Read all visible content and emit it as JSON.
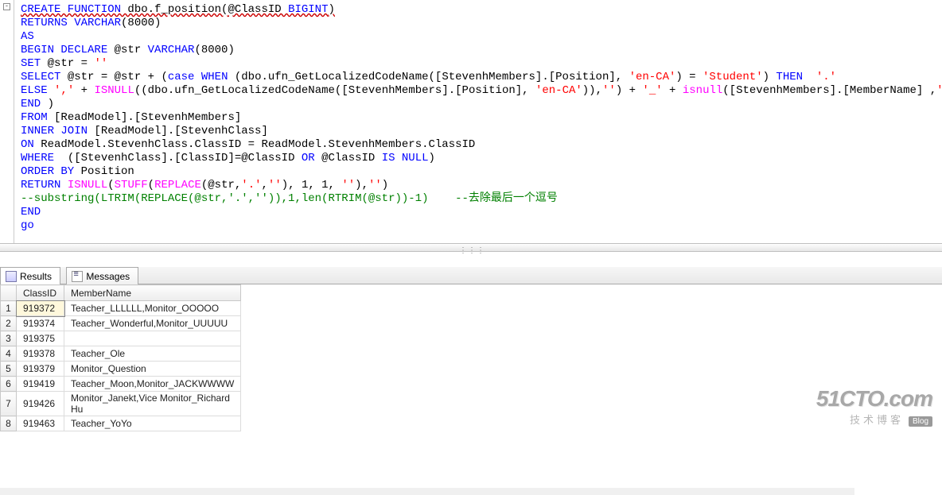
{
  "code": {
    "tokens": [
      [
        {
          "t": "CREATE FUNCTION",
          "c": "kw underline-squiggle"
        },
        {
          "t": " dbo.f_position(@ClassID ",
          "c": "underline-squiggle"
        },
        {
          "t": "BIGINT",
          "c": "kw underline-squiggle"
        },
        {
          "t": ")",
          "c": "underline-squiggle"
        }
      ],
      [
        {
          "t": "RETURNS VARCHAR",
          "c": "kw"
        },
        {
          "t": "(8000)"
        }
      ],
      [
        {
          "t": "AS",
          "c": "kw"
        }
      ],
      [
        {
          "t": "BEGIN DECLARE",
          "c": "kw"
        },
        {
          "t": " @str "
        },
        {
          "t": "VARCHAR",
          "c": "kw"
        },
        {
          "t": "(8000)"
        }
      ],
      [
        {
          "t": "SET",
          "c": "kw"
        },
        {
          "t": " @str = "
        },
        {
          "t": "''",
          "c": "str"
        }
      ],
      [
        {
          "t": "SELECT",
          "c": "kw"
        },
        {
          "t": " @str = @str + ("
        },
        {
          "t": "case",
          "c": "kw"
        },
        {
          "t": " "
        },
        {
          "t": "WHEN",
          "c": "kw"
        },
        {
          "t": " (dbo.ufn_GetLocalizedCodeName([StevenhMembers].[Position], "
        },
        {
          "t": "'en-CA'",
          "c": "str"
        },
        {
          "t": ") = "
        },
        {
          "t": "'Student'",
          "c": "str"
        },
        {
          "t": ") "
        },
        {
          "t": "THEN",
          "c": "kw"
        },
        {
          "t": "  "
        },
        {
          "t": "'.'",
          "c": "str"
        }
      ],
      [
        {
          "t": "ELSE",
          "c": "kw"
        },
        {
          "t": " "
        },
        {
          "t": "','",
          "c": "str"
        },
        {
          "t": " + "
        },
        {
          "t": "ISNULL",
          "c": "fn"
        },
        {
          "t": "((dbo.ufn_GetLocalizedCodeName([StevenhMembers].[Position], "
        },
        {
          "t": "'en-CA'",
          "c": "str"
        },
        {
          "t": ")),"
        },
        {
          "t": "''",
          "c": "str"
        },
        {
          "t": ") + "
        },
        {
          "t": "'_'",
          "c": "str"
        },
        {
          "t": " + "
        },
        {
          "t": "isnull",
          "c": "fn"
        },
        {
          "t": "([StevenhMembers].[MemberName] ,"
        },
        {
          "t": "''",
          "c": "str"
        },
        {
          "t": ")"
        }
      ],
      [
        {
          "t": "END",
          "c": "kw"
        },
        {
          "t": " )"
        }
      ],
      [
        {
          "t": "FROM",
          "c": "kw"
        },
        {
          "t": " [ReadModel].[StevenhMembers]"
        }
      ],
      [
        {
          "t": "INNER JOIN",
          "c": "kw"
        },
        {
          "t": " [ReadModel].[StevenhClass]"
        }
      ],
      [
        {
          "t": "ON",
          "c": "kw"
        },
        {
          "t": " ReadModel.StevenhClass.ClassID = ReadModel.StevenhMembers.ClassID"
        }
      ],
      [
        {
          "t": "WHERE",
          "c": "kw"
        },
        {
          "t": "  ([StevenhClass].[ClassID]=@ClassID "
        },
        {
          "t": "OR",
          "c": "kw"
        },
        {
          "t": " @ClassID "
        },
        {
          "t": "IS NULL",
          "c": "kw"
        },
        {
          "t": ")"
        }
      ],
      [
        {
          "t": "ORDER BY",
          "c": "kw"
        },
        {
          "t": " Position"
        }
      ],
      [
        {
          "t": "RETURN ",
          "c": "kw"
        },
        {
          "t": "ISNULL",
          "c": "fn"
        },
        {
          "t": "("
        },
        {
          "t": "STUFF",
          "c": "fn"
        },
        {
          "t": "("
        },
        {
          "t": "REPLACE",
          "c": "fn"
        },
        {
          "t": "(@str,"
        },
        {
          "t": "'.'",
          "c": "str"
        },
        {
          "t": ","
        },
        {
          "t": "''",
          "c": "str"
        },
        {
          "t": "), 1, 1, "
        },
        {
          "t": "''",
          "c": "str"
        },
        {
          "t": "),"
        },
        {
          "t": "''",
          "c": "str"
        },
        {
          "t": ")"
        }
      ],
      [
        {
          "t": "--substring(LTRIM(REPLACE(@str,'.','')),1,len(RTRIM(@str))-1)    --去除最后一个逗号",
          "c": "cmt"
        }
      ],
      [
        {
          "t": "END",
          "c": "kw"
        }
      ],
      [
        {
          "t": "go",
          "c": "kw"
        }
      ]
    ]
  },
  "tabs": {
    "results": "Results",
    "messages": "Messages"
  },
  "grid": {
    "headers": {
      "classid": "ClassID",
      "member": "MemberName"
    },
    "rows": [
      {
        "n": "1",
        "classid": "919372",
        "member": "Teacher_LLLLLL,Monitor_OOOOO"
      },
      {
        "n": "2",
        "classid": "919374",
        "member": "Teacher_Wonderful,Monitor_UUUUU"
      },
      {
        "n": "3",
        "classid": "919375",
        "member": ""
      },
      {
        "n": "4",
        "classid": "919378",
        "member": "Teacher_Ole"
      },
      {
        "n": "5",
        "classid": "919379",
        "member": "Monitor_Question"
      },
      {
        "n": "6",
        "classid": "919419",
        "member": "Teacher_Moon,Monitor_JACKWWWW"
      },
      {
        "n": "7",
        "classid": "919426",
        "member": "Monitor_Janekt,Vice Monitor_Richard Hu"
      },
      {
        "n": "8",
        "classid": "919463",
        "member": "Teacher_YoYo"
      }
    ]
  },
  "watermark": {
    "line1": "51CTO.com",
    "line2": "技术博客",
    "badge": "Blog"
  },
  "fold": "-"
}
